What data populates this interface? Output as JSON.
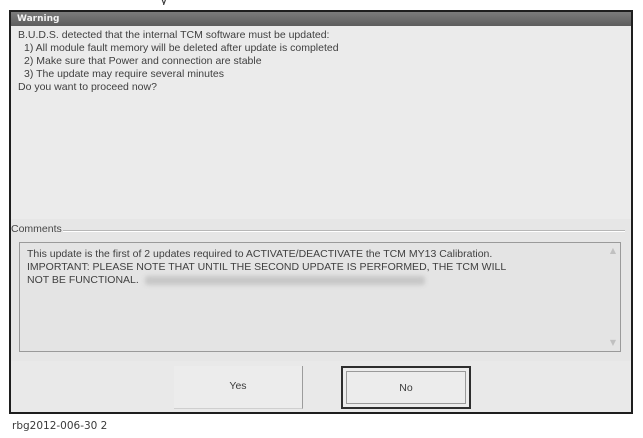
{
  "top_fragment": "y",
  "dialog": {
    "title": "Warning",
    "message_lines": [
      "B.U.D.S. detected that the internal TCM software must be updated:",
      "1) All module fault memory will be deleted after update is completed",
      "2) Make sure that Power and connection are stable",
      "3) The update may require several minutes",
      "Do you want to proceed now?"
    ],
    "comments_label": "Comments",
    "comment_lines": [
      "This update is the first of 2 updates required to ACTIVATE/DEACTIVATE the TCM MY13 Calibration.",
      "IMPORTANT: PLEASE NOTE THAT UNTIL THE SECOND UPDATE IS PERFORMED, THE TCM WILL",
      "NOT BE FUNCTIONAL."
    ],
    "yes_label": "Yes",
    "no_label": "No"
  },
  "caption": "rbg2012-006-30 2"
}
